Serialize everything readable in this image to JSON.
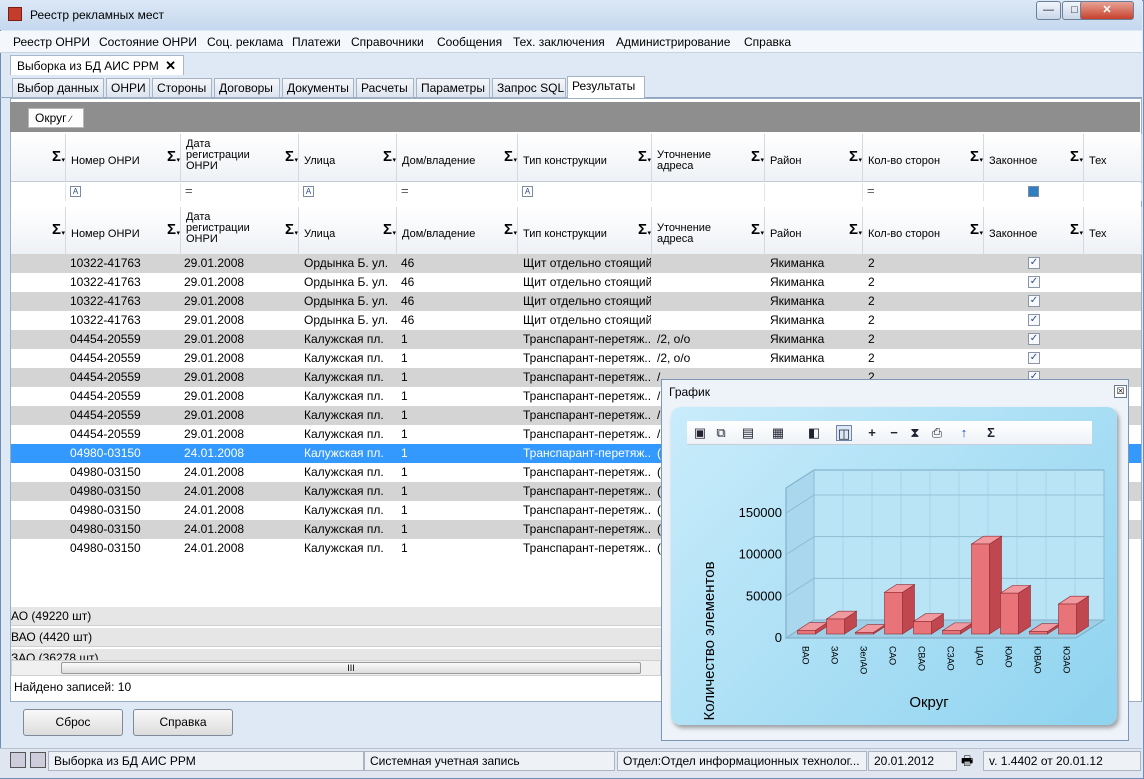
{
  "window": {
    "title": "Реестр рекламных мест",
    "min_label": "—",
    "max_label": "□",
    "close_label": "✕"
  },
  "menu": [
    "Реестр ОНРИ",
    "Состояние ОНРИ",
    "Соц. реклама",
    "Платежи",
    "Справочники",
    "Сообщения",
    "Тех. заключения",
    "Администрирование",
    "Справка"
  ],
  "doc_tab": {
    "label": "Выборка из БД АИС РРМ",
    "close": "✕"
  },
  "tabs": [
    "Выбор данных",
    "ОНРИ",
    "Стороны",
    "Договоры",
    "Документы",
    "Расчеты",
    "Параметры",
    "Запрос SQL",
    "Результаты"
  ],
  "active_tab": "Результаты",
  "group_chip": "Округ",
  "columns": [
    "Номер ОНРИ",
    "Дата регистрации ОНРИ",
    "Улица",
    "Дом/владение",
    "Тип конструкции",
    "Уточнение адреса",
    "Район",
    "Кол-во сторон",
    "Законное",
    "Тех"
  ],
  "sigma": "Σ",
  "rows": [
    {
      "num": "10322-41763",
      "date": "29.01.2008",
      "street": "Ордынка Б. ул.",
      "house": "46",
      "type": "Щит отдельно стоящий",
      "addr": "",
      "district": "Якиманка",
      "sides": "2",
      "legal": true
    },
    {
      "num": "10322-41763",
      "date": "29.01.2008",
      "street": "Ордынка Б. ул.",
      "house": "46",
      "type": "Щит отдельно стоящий",
      "addr": "",
      "district": "Якиманка",
      "sides": "2",
      "legal": true
    },
    {
      "num": "10322-41763",
      "date": "29.01.2008",
      "street": "Ордынка Б. ул.",
      "house": "46",
      "type": "Щит отдельно стоящий",
      "addr": "",
      "district": "Якиманка",
      "sides": "2",
      "legal": true
    },
    {
      "num": "10322-41763",
      "date": "29.01.2008",
      "street": "Ордынка Б. ул.",
      "house": "46",
      "type": "Щит отдельно стоящий",
      "addr": "",
      "district": "Якиманка",
      "sides": "2",
      "legal": true
    },
    {
      "num": "04454-20559",
      "date": "29.01.2008",
      "street": "Калужская пл.",
      "house": "1",
      "type": "Транспарант-перетяж...",
      "addr": "/2, о/о",
      "district": "Якиманка",
      "sides": "2",
      "legal": true
    },
    {
      "num": "04454-20559",
      "date": "29.01.2008",
      "street": "Калужская пл.",
      "house": "1",
      "type": "Транспарант-перетяж...",
      "addr": "/2, о/о",
      "district": "Якиманка",
      "sides": "2",
      "legal": true
    },
    {
      "num": "04454-20559",
      "date": "29.01.2008",
      "street": "Калужская пл.",
      "house": "1",
      "type": "Транспарант-перетяж...",
      "addr": "/",
      "district": "",
      "sides": "2",
      "legal": true
    },
    {
      "num": "04454-20559",
      "date": "29.01.2008",
      "street": "Калужская пл.",
      "house": "1",
      "type": "Транспарант-перетяж...",
      "addr": "/",
      "district": "",
      "sides": "",
      "legal": false
    },
    {
      "num": "04454-20559",
      "date": "29.01.2008",
      "street": "Калужская пл.",
      "house": "1",
      "type": "Транспарант-перетяж...",
      "addr": "/",
      "district": "",
      "sides": "",
      "legal": false
    },
    {
      "num": "04454-20559",
      "date": "29.01.2008",
      "street": "Калужская пл.",
      "house": "1",
      "type": "Транспарант-перетяж...",
      "addr": "/",
      "district": "",
      "sides": "",
      "legal": false
    },
    {
      "num": "04980-03150",
      "date": "24.01.2008",
      "street": "Калужская пл.",
      "house": "1",
      "type": "Транспарант-перетяж...",
      "addr": "(",
      "district": "",
      "sides": "",
      "legal": false
    },
    {
      "num": "04980-03150",
      "date": "24.01.2008",
      "street": "Калужская пл.",
      "house": "1",
      "type": "Транспарант-перетяж...",
      "addr": "(",
      "district": "",
      "sides": "",
      "legal": false
    },
    {
      "num": "04980-03150",
      "date": "24.01.2008",
      "street": "Калужская пл.",
      "house": "1",
      "type": "Транспарант-перетяж...",
      "addr": "(",
      "district": "",
      "sides": "",
      "legal": false
    },
    {
      "num": "04980-03150",
      "date": "24.01.2008",
      "street": "Калужская пл.",
      "house": "1",
      "type": "Транспарант-перетяж...",
      "addr": "(",
      "district": "",
      "sides": "",
      "legal": false
    },
    {
      "num": "04980-03150",
      "date": "24.01.2008",
      "street": "Калужская пл.",
      "house": "1",
      "type": "Транспарант-перетяж...",
      "addr": "(",
      "district": "",
      "sides": "",
      "legal": false
    },
    {
      "num": "04980-03150",
      "date": "24.01.2008",
      "street": "Калужская пл.",
      "house": "1",
      "type": "Транспарант-перетяж...",
      "addr": "(",
      "district": "",
      "sides": "",
      "legal": false
    }
  ],
  "group_rows": [
    "АО (49220 шт)",
    "ВАО (4420 шт)",
    "ЗАО (36278 шт)"
  ],
  "scroll_thumb": "III",
  "found": "Найдено записей: 10",
  "buttons": {
    "reset": "Сброс",
    "help": "Справка"
  },
  "status": {
    "section": "Выборка из БД АИС РРМ",
    "account": "Системная учетная запись",
    "dept": "Отдел:Отдел информационных технолог...",
    "date": "20.01.2012",
    "version": "v. 1.4402 от 20.01.12"
  },
  "graph": {
    "title": "График",
    "close": "☒"
  },
  "chart_data": {
    "type": "bar",
    "categories": [
      "ВАО",
      "ЗАО",
      "ЗелАО",
      "САО",
      "СВАО",
      "СЗАО",
      "ЦАО",
      "ЮАО",
      "ЮВАО",
      "ЮЗАО"
    ],
    "values": [
      4420,
      18000,
      2000,
      50000,
      15000,
      4000,
      108000,
      49000,
      3000,
      36000
    ],
    "title": "",
    "xlabel": "Округ",
    "ylabel": "Количество элементов",
    "yticks": [
      "0",
      "50000",
      "100000",
      "150000"
    ],
    "ylim": [
      0,
      180000
    ],
    "bar_color": "#e8747a"
  }
}
